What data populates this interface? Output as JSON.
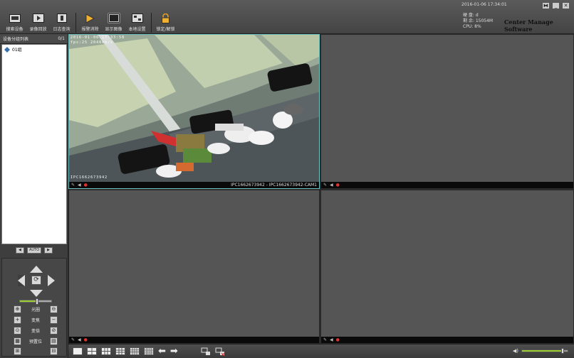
{
  "header": {
    "datetime": "2016-01-06 17:34:01",
    "brand": "Center Manage Software",
    "stats": [
      "硬 盘: d",
      "剩 余: 15054M",
      "CPU: 8%"
    ],
    "window_buttons": [
      "⧓",
      "_",
      "✕"
    ]
  },
  "toolbar": [
    {
      "label": "搜索设备",
      "icon": "search-device-icon"
    },
    {
      "label": "录像回放",
      "icon": "playback-icon"
    },
    {
      "label": "日志查询",
      "icon": "log-icon"
    },
    {
      "label": "报警消除",
      "icon": "alarm-clear-icon"
    },
    {
      "label": "显示图像",
      "icon": "display-image-icon",
      "active": true
    },
    {
      "label": "本地设置",
      "icon": "local-settings-icon"
    },
    {
      "label": "锁定/解锁",
      "icon": "lock-icon"
    }
  ],
  "sidebar": {
    "title": "设备分组列表",
    "count": "0/1",
    "tree": [
      {
        "label": "01组"
      }
    ],
    "pager": {
      "prev": "◀",
      "auto": "AUTO",
      "next": "▶"
    },
    "ptz": {
      "center_glyph": "⟳",
      "speed": 0.55,
      "rows": [
        {
          "label": "光圈",
          "left": "⊕",
          "right": "⊖"
        },
        {
          "label": "变焦",
          "left": "+",
          "right": "−"
        },
        {
          "label": "变倍",
          "left": "⊙",
          "right": "⊘"
        },
        {
          "label": "预置位",
          "left": "▦",
          "right": "▤"
        },
        {
          "label": "",
          "left": "⊞",
          "right": "⊟"
        }
      ]
    }
  },
  "video": {
    "cells": [
      {
        "caption": "IPC1662673942 - IPC1662673942-CAM1",
        "osd_top": "2016-01-06 17:33:58",
        "osd_line2": "fps:25 2048kb/s",
        "osd_bottom": "IPC1662673942",
        "has_feed": true,
        "selected": true
      },
      {
        "caption": "",
        "has_feed": false
      },
      {
        "caption": "",
        "has_feed": false
      },
      {
        "caption": "",
        "has_feed": false
      }
    ],
    "bar_icons": {
      "edit": "✎",
      "speaker": "◀",
      "rec": "●"
    }
  },
  "bottombar": {
    "layouts": [
      {
        "name": "1",
        "label": ""
      },
      {
        "name": "4",
        "label": ""
      },
      {
        "name": "6",
        "label": ""
      },
      {
        "name": "9",
        "label": ""
      },
      {
        "name": "16",
        "label": ""
      },
      {
        "name": "25",
        "label": ""
      }
    ],
    "prev_arrow": "⬅",
    "next_arrow": "➡",
    "volume": 0.9,
    "volume_icon_glyph": "◀)"
  }
}
